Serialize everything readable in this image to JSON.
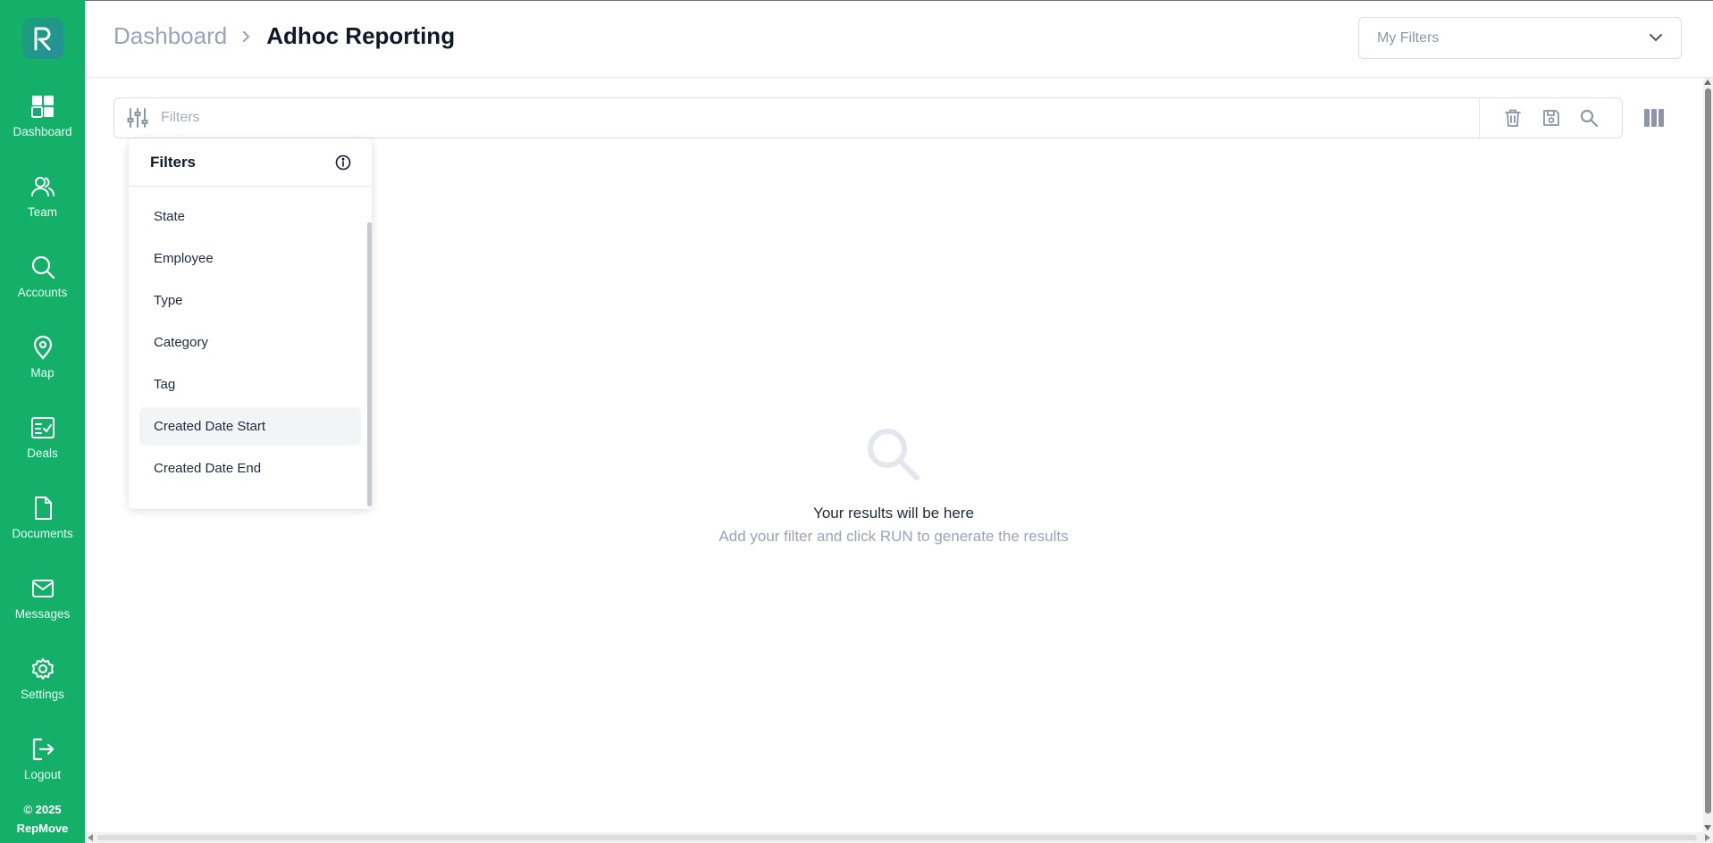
{
  "colors": {
    "sidebar_bg": "#14b06a",
    "icon_gray": "#8d96a8",
    "muted_text": "#9aa3b8"
  },
  "sidebar": {
    "logo_icon": "repmove-logo-icon",
    "items": [
      {
        "label": "Dashboard",
        "icon": "dashboard-grid-icon"
      },
      {
        "label": "Team",
        "icon": "team-users-icon"
      },
      {
        "label": "Accounts",
        "icon": "search-icon"
      },
      {
        "label": "Map",
        "icon": "map-pin-icon"
      },
      {
        "label": "Deals",
        "icon": "deals-checklist-icon"
      },
      {
        "label": "Documents",
        "icon": "document-icon"
      },
      {
        "label": "Messages",
        "icon": "envelope-icon"
      },
      {
        "label": "Settings",
        "icon": "gear-icon"
      },
      {
        "label": "Logout",
        "icon": "logout-icon"
      }
    ],
    "footer_year": "© 2025",
    "footer_brand": "RepMove"
  },
  "header": {
    "breadcrumb_parent": "Dashboard",
    "breadcrumb_current": "Adhoc Reporting",
    "my_filters_placeholder": "My Filters"
  },
  "filterbar": {
    "placeholder": "Filters",
    "actions": [
      "trash-icon",
      "save-icon",
      "search-icon"
    ],
    "columns_icon": "columns-icon"
  },
  "filters_dropdown": {
    "title": "Filters",
    "items": [
      "State",
      "Employee",
      "Type",
      "Category",
      "Tag",
      "Created Date Start",
      "Created Date End"
    ],
    "highlighted_item": "Created Date Start"
  },
  "empty_state": {
    "title": "Your results will be here",
    "subtitle": "Add your filter and click RUN to generate the results"
  }
}
